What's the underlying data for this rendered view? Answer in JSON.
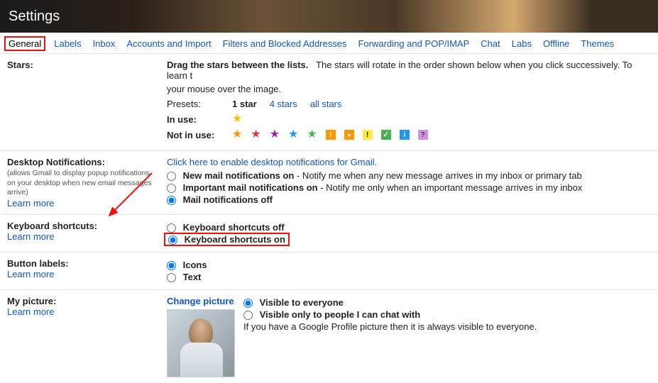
{
  "title": "Settings",
  "tabs": [
    "General",
    "Labels",
    "Inbox",
    "Accounts and Import",
    "Filters and Blocked Addresses",
    "Forwarding and POP/IMAP",
    "Chat",
    "Labs",
    "Offline",
    "Themes"
  ],
  "stars": {
    "title": "Stars:",
    "instr_bold": "Drag the stars between the lists.",
    "instr_rest": "The stars will rotate in the order shown below when you click successively. To learn t",
    "instr_line2": "your mouse over the image.",
    "presets_label": "Presets:",
    "preset_1": "1 star",
    "preset_4": "4 stars",
    "preset_all": "all stars",
    "in_use": "In use:",
    "not_in_use": "Not in use:"
  },
  "desktop": {
    "title": "Desktop Notifications:",
    "sub": "(allows Gmail to display popup notifications on your desktop when new email messages arrive)",
    "learn": "Learn more",
    "enable_link": "Click here to enable desktop notifications for Gmail.",
    "opt1_b": "New mail notifications on",
    "opt1_r": " - Notify me when any new message arrives in my inbox or primary tab",
    "opt2_b": "Important mail notifications on",
    "opt2_r": " - Notify me only when an important message arrives in my inbox",
    "opt3_b": "Mail notifications off"
  },
  "keyboard": {
    "title": "Keyboard shortcuts:",
    "learn": "Learn more",
    "off": "Keyboard shortcuts off",
    "on": "Keyboard shortcuts on"
  },
  "buttons": {
    "title": "Button labels:",
    "learn": "Learn more",
    "icons": "Icons",
    "text": "Text"
  },
  "picture": {
    "title": "My picture:",
    "learn": "Learn more",
    "change": "Change picture",
    "opt1": "Visible to everyone",
    "opt2": "Visible only to people I can chat with",
    "note": "If you have a Google Profile picture then it is always visible to everyone."
  }
}
